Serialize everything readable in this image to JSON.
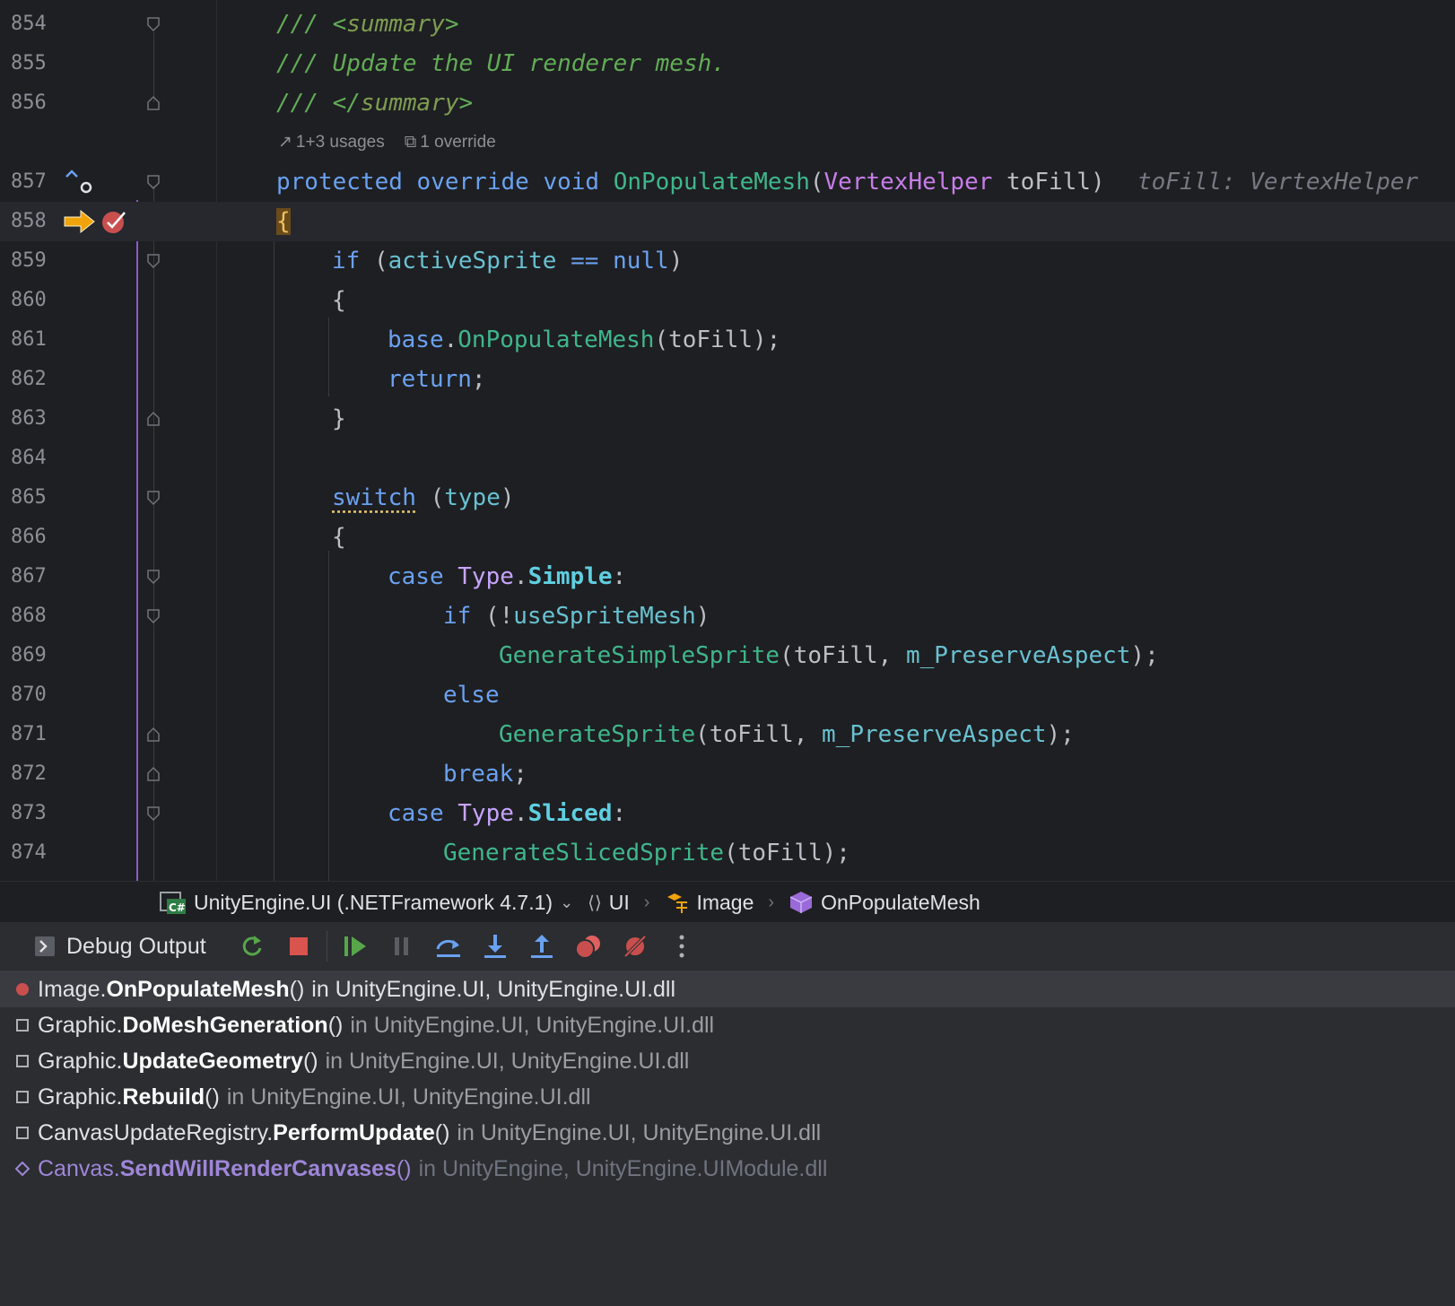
{
  "editor": {
    "codelens": {
      "usages": "1+3 usages",
      "overrides": "1 override"
    },
    "inlay_hint": "toFill: VertexHelper",
    "lines": [
      {
        "n": "854"
      },
      {
        "n": "855"
      },
      {
        "n": "856"
      },
      {
        "n": "857"
      },
      {
        "n": "858"
      },
      {
        "n": "859"
      },
      {
        "n": "860"
      },
      {
        "n": "861"
      },
      {
        "n": "862"
      },
      {
        "n": "863"
      },
      {
        "n": "864"
      },
      {
        "n": "865"
      },
      {
        "n": "866"
      },
      {
        "n": "867"
      },
      {
        "n": "868"
      },
      {
        "n": "869"
      },
      {
        "n": "870"
      },
      {
        "n": "871"
      },
      {
        "n": "872"
      },
      {
        "n": "873"
      },
      {
        "n": "874"
      }
    ],
    "tokens": {
      "l854_a": "/// <",
      "l854_b": "summary",
      "l854_c": ">",
      "l855": "/// Update the UI renderer mesh.",
      "l856_a": "/// </",
      "l856_b": "summary",
      "l856_c": ">",
      "l857_protected": "protected",
      "l857_override": "override",
      "l857_void": "void",
      "l857_method": "OnPopulateMesh",
      "l857_open": "(",
      "l857_type": "VertexHelper",
      "l857_param": " toFill)",
      "l858_brace": "{",
      "l859_if": "if",
      "l859_open": " (",
      "l859_var": "activeSprite",
      "l859_op": " == ",
      "l859_null": "null",
      "l859_close": ")",
      "l860": "{",
      "l861_base": "base",
      "l861_dot": ".",
      "l861_method": "OnPopulateMesh",
      "l861_rest": "(toFill);",
      "l862_return": "return",
      "l862_semi": ";",
      "l863": "}",
      "l865_switch": "switch",
      "l865_open": " (",
      "l865_type": "type",
      "l865_close": ")",
      "l866": "{",
      "l867_case": "case",
      "l867_type": "Type",
      "l867_dot": ".",
      "l867_value": "Simple",
      "l867_colon": ":",
      "l868_if": "if",
      "l868_open": " (!",
      "l868_var": "useSpriteMesh",
      "l868_close": ")",
      "l869_method": "GenerateSimpleSprite",
      "l869_a": "(toFill, ",
      "l869_field": "m_PreserveAspect",
      "l869_b": ");",
      "l870_else": "else",
      "l871_method": "GenerateSprite",
      "l871_a": "(toFill, ",
      "l871_field": "m_PreserveAspect",
      "l871_b": ");",
      "l872_break": "break",
      "l872_semi": ";",
      "l873_case": "case",
      "l873_type": "Type",
      "l873_dot": ".",
      "l873_value": "Sliced",
      "l873_colon": ":",
      "l874_method": "GenerateSlicedSprite",
      "l874_rest": "(toFill);"
    }
  },
  "breadcrumb": {
    "project": "UnityEngine.UI (.NETFramework 4.7.1)",
    "namespace": "UI",
    "class": "Image",
    "method": "OnPopulateMesh"
  },
  "debug_panel": {
    "title": "Debug Output",
    "toolbar": [
      "rerun-icon",
      "stop-icon",
      "resume-icon",
      "pause-icon",
      "step-over-icon",
      "step-into-icon",
      "step-out-icon",
      "view-breakpoints-icon",
      "mute-breakpoints-icon",
      "more-icon"
    ],
    "frames": [
      {
        "cls": "Image.",
        "method": "OnPopulateMesh",
        "paren": "()",
        "loc": "in UnityEngine.UI, UnityEngine.UI.dll"
      },
      {
        "cls": "Graphic.",
        "method": "DoMeshGeneration",
        "paren": "()",
        "loc": "in UnityEngine.UI, UnityEngine.UI.dll"
      },
      {
        "cls": "Graphic.",
        "method": "UpdateGeometry",
        "paren": "()",
        "loc": "in UnityEngine.UI, UnityEngine.UI.dll"
      },
      {
        "cls": "Graphic.",
        "method": "Rebuild",
        "paren": "()",
        "loc": "in UnityEngine.UI, UnityEngine.UI.dll"
      },
      {
        "cls": "CanvasUpdateRegistry.",
        "method": "PerformUpdate",
        "paren": "()",
        "loc": "in UnityEngine.UI, UnityEngine.UI.dll"
      },
      {
        "cls": "Canvas.",
        "method": "SendWillRenderCanvases",
        "paren": "()",
        "loc": "in UnityEngine, UnityEngine.UIModule.dll"
      }
    ]
  },
  "colors": {
    "keyword": "#6aa1f0",
    "method": "#3fb68b",
    "type": "#c77dea",
    "comment": "#62ac56",
    "breakpoint": "#c94f4f",
    "execution_arrow": "#f0a30a"
  }
}
